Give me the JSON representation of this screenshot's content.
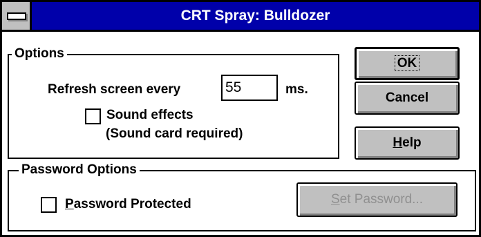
{
  "window": {
    "title": "CRT Spray: Bulldozer"
  },
  "options": {
    "legend": "Options",
    "refresh_prefix": "Refresh screen every",
    "refresh_value": "55",
    "refresh_suffix": "ms.",
    "sound_effects_label": "Sound effects",
    "sound_note": "(Sound card required)",
    "sound_effects_checked": false
  },
  "password_options": {
    "legend": "Password Options",
    "protected_label_rest": "assword Protected",
    "protected_label_mnemonic": "P",
    "protected_checked": false,
    "set_password_mnemonic": "S",
    "set_password_rest": "et Password..."
  },
  "buttons": {
    "ok": "OK",
    "cancel": "Cancel",
    "help_mnemonic": "H",
    "help_rest": "elp"
  }
}
